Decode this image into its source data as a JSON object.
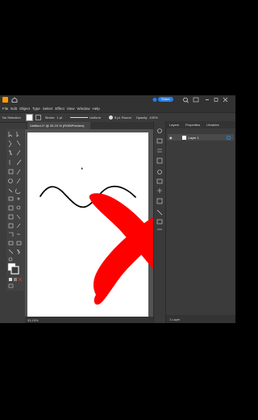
{
  "menu": [
    "File",
    "Edit",
    "Object",
    "Type",
    "Select",
    "Effect",
    "View",
    "Window",
    "Help"
  ],
  "titlebar": {
    "share_label": "Share"
  },
  "control_bar": {
    "selection_label": "No Selection",
    "stroke_label": "Stroke:",
    "stroke_value": "1 pt",
    "profile_label": "Uniform",
    "brush_label": "5 pt. Round",
    "opacity_label": "Opacity:",
    "opacity_value": "100%"
  },
  "document_tab": "Untitled-1* @ 33.15 % (RGB/Preview)",
  "panel_tabs": [
    "Layers",
    "Properties",
    "Libraries"
  ],
  "layers": [
    {
      "name": "Layer 1"
    }
  ],
  "panel_footer": "1 Layer",
  "status": {
    "zoom": "33.15%"
  },
  "colors": {
    "accent": "#2680eb",
    "overlay_x": "#ff0000",
    "artboard": "#ffffff"
  }
}
